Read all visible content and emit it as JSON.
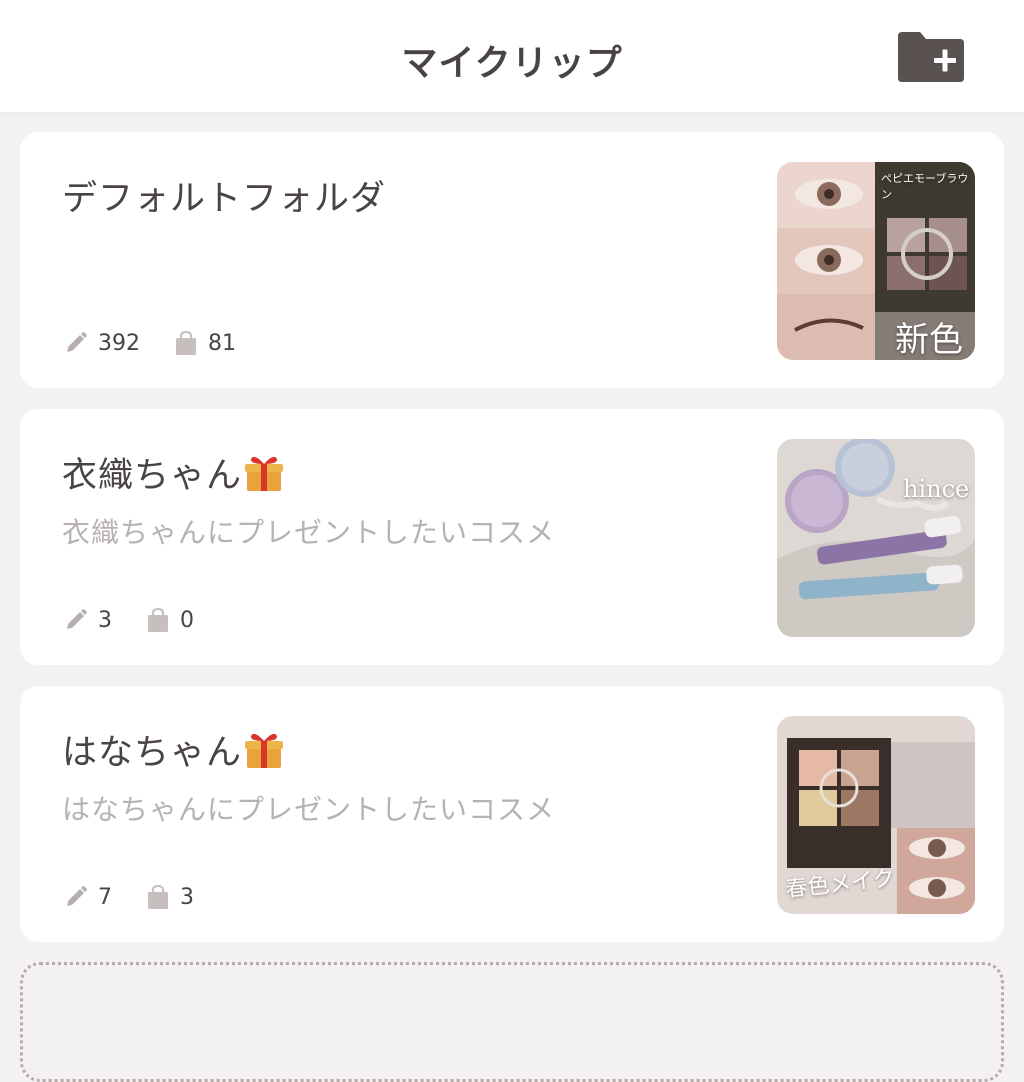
{
  "header": {
    "title": "マイクリップ",
    "add_folder_icon": "folder-plus-icon"
  },
  "folders": [
    {
      "title": "デフォルトフォルダ",
      "description": "",
      "gift": false,
      "posts": "392",
      "items": "81",
      "thumb_label": "新色",
      "thumb_caption": "ぺピエモーブラウン"
    },
    {
      "title": "衣織ちゃん",
      "description": "衣織ちゃんにプレゼントしたいコスメ",
      "gift": true,
      "posts": "3",
      "items": "0",
      "thumb_label": "hince"
    },
    {
      "title": "はなちゃん",
      "description": "はなちゃんにプレゼントしたいコスメ",
      "gift": true,
      "posts": "7",
      "items": "3",
      "thumb_label": "春色メイク"
    }
  ],
  "icons": {
    "posts": "pencil-icon",
    "items": "shopping-bag-icon",
    "gift": "gift-icon"
  },
  "colors": {
    "background": "#f3f1f1",
    "text": "#4a4343",
    "subtext": "#b8b1b1",
    "icon": "#b7aeae",
    "header_icon": "#5a5151"
  }
}
